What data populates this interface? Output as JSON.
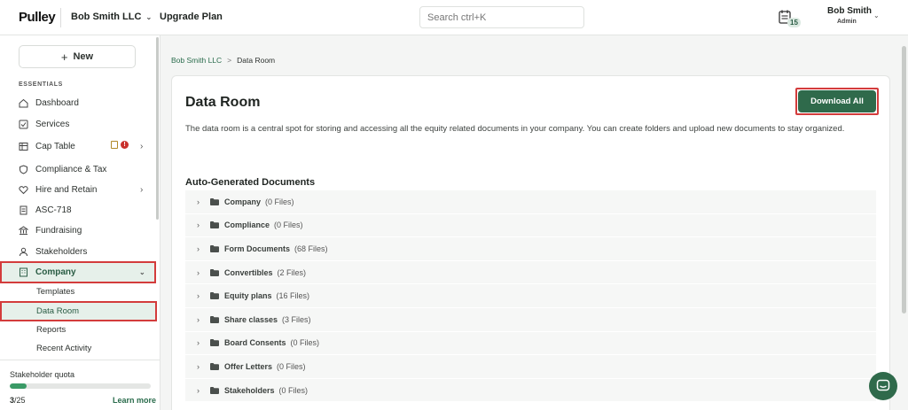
{
  "header": {
    "logo": "Pulley",
    "org_name": "Bob Smith LLC",
    "upgrade_label": "Upgrade Plan",
    "search_placeholder": "Search ctrl+K",
    "calendar_badge": "15",
    "user_name": "Bob Smith",
    "user_role": "Admin"
  },
  "sidebar": {
    "new_label": "New",
    "section_label": "ESSENTIALS",
    "items": [
      {
        "label": "Dashboard",
        "icon": "home-icon"
      },
      {
        "label": "Services",
        "icon": "checkbox-icon"
      },
      {
        "label": "Cap Table",
        "icon": "table-icon",
        "badge": "!"
      },
      {
        "label": "Compliance & Tax",
        "icon": "shield-icon"
      },
      {
        "label": "Hire and Retain",
        "icon": "heart-icon"
      },
      {
        "label": "ASC-718",
        "icon": "document-icon"
      },
      {
        "label": "Fundraising",
        "icon": "bank-icon"
      },
      {
        "label": "Stakeholders",
        "icon": "people-icon"
      },
      {
        "label": "Company",
        "icon": "building-icon"
      }
    ],
    "sub_items": [
      {
        "label": "Templates"
      },
      {
        "label": "Data Room"
      },
      {
        "label": "Reports"
      },
      {
        "label": "Recent Activity"
      }
    ],
    "quota": {
      "title": "Stakeholder quota",
      "used": "3",
      "total": "/25",
      "fraction": 0.12,
      "link": "Learn more"
    }
  },
  "breadcrumb": {
    "parent": "Bob Smith LLC",
    "separator": ">",
    "current": "Data Room"
  },
  "main": {
    "title": "Data Room",
    "download_label": "Download All",
    "description": "The data room is a central spot for storing and accessing all the equity related documents in your company. You can create folders and upload new documents to stay organized.",
    "section_title": "Auto-Generated Documents",
    "folders": [
      {
        "name": "Company",
        "count": "(0 Files)"
      },
      {
        "name": "Compliance",
        "count": "(0 Files)"
      },
      {
        "name": "Form Documents",
        "count": "(68 Files)"
      },
      {
        "name": "Convertibles",
        "count": "(2 Files)"
      },
      {
        "name": "Equity plans",
        "count": "(16 Files)"
      },
      {
        "name": "Share classes",
        "count": "(3 Files)"
      },
      {
        "name": "Board Consents",
        "count": "(0 Files)"
      },
      {
        "name": "Offer Letters",
        "count": "(0 Files)"
      },
      {
        "name": "Stakeholders",
        "count": "(0 Files)"
      }
    ]
  },
  "colors": {
    "brand_green": "#2f6a4b",
    "highlight_red": "#d33c3c",
    "active_bg": "#e6f0ea"
  }
}
